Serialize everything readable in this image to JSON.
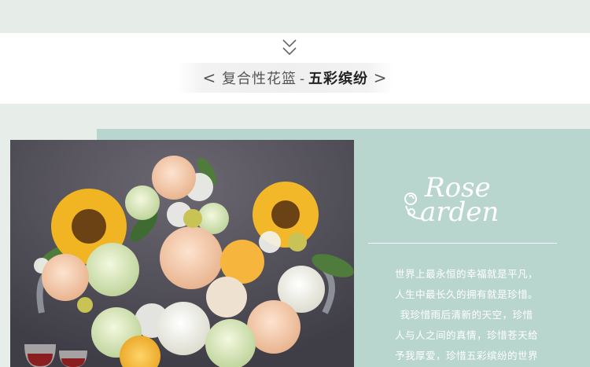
{
  "header": {
    "open_bracket": "<",
    "category": "复合性花篮",
    "separator": "-",
    "product_name": "五彩缤纷",
    "close_bracket": ">",
    "scroll_icon": "double-chevron-down-icon"
  },
  "brand": {
    "logo_line1": "Rose",
    "logo_line2": "arden",
    "logo_icon": "rose-flower-icon"
  },
  "description": {
    "lines": [
      "世界上最永恒的幸福就是平凡，",
      "人生中最长久的拥有就是珍惜。",
      "我珍惜雨后清新的天空，珍惜",
      "人与人之间的真情，珍惜苍天给",
      "予我厚爱，珍惜五彩缤纷的世界"
    ]
  },
  "product_image": {
    "alt_icon": "flower-basket-photo"
  },
  "colors": {
    "mint_panel": "#b9d6ce",
    "page_bg": "#e7ede9",
    "text_white": "#ffffff"
  }
}
